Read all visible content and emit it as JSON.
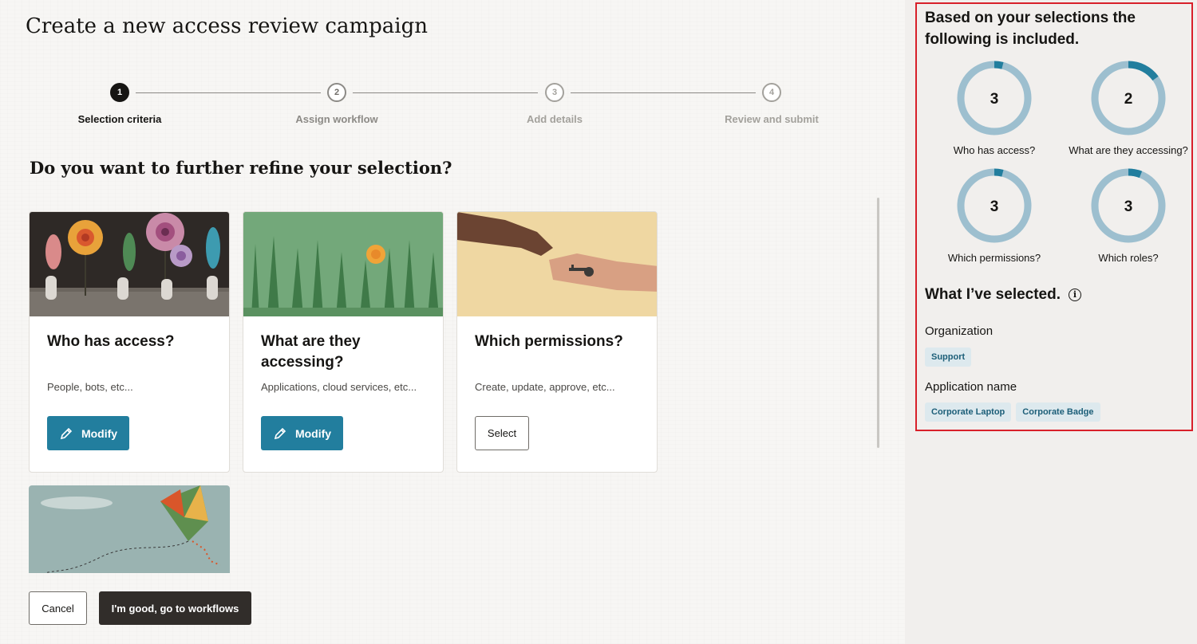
{
  "page": {
    "title": "Create a new access review campaign",
    "subheading": "Do you want to further refine your selection?"
  },
  "stepper": [
    {
      "number": "1",
      "label": "Selection criteria",
      "state": "active"
    },
    {
      "number": "2",
      "label": "Assign workflow",
      "state": "pending"
    },
    {
      "number": "3",
      "label": "Add details",
      "state": "upcoming"
    },
    {
      "number": "4",
      "label": "Review and submit",
      "state": "upcoming"
    }
  ],
  "cards": [
    {
      "title": "Who has access?",
      "description": "People, bots, etc...",
      "button": "Modify"
    },
    {
      "title": "What are they accessing?",
      "description": "Applications, cloud services, etc...",
      "button": "Modify"
    },
    {
      "title": "Which permissions?",
      "description": "Create, update, approve, etc...",
      "button": "Select"
    }
  ],
  "footer": {
    "cancel_label": "Cancel",
    "go_label": "I'm good, go to workflows"
  },
  "panel": {
    "heading": "Based on your selections the following is included.",
    "donuts": [
      {
        "value": "3",
        "label": "Who has access?",
        "fraction": 0.04
      },
      {
        "value": "2",
        "label": "What are they accessing?",
        "fraction": 0.15
      },
      {
        "value": "3",
        "label": "Which permissions?",
        "fraction": 0.04
      },
      {
        "value": "3",
        "label": "Which roles?",
        "fraction": 0.06
      }
    ],
    "selected_heading": "What I’ve selected.",
    "info_icon": "info-icon",
    "groups": [
      {
        "label": "Organization",
        "chips": [
          "Support"
        ]
      },
      {
        "label": "Application name",
        "chips": [
          "Corporate Laptop",
          "Corporate Badge"
        ]
      }
    ]
  },
  "colors": {
    "accent": "#227e9e",
    "donut_track": "#9dbfcf",
    "donut_fill": "#227e9e",
    "highlight_frame": "#d8202a",
    "primary_dark": "#312d2a"
  }
}
